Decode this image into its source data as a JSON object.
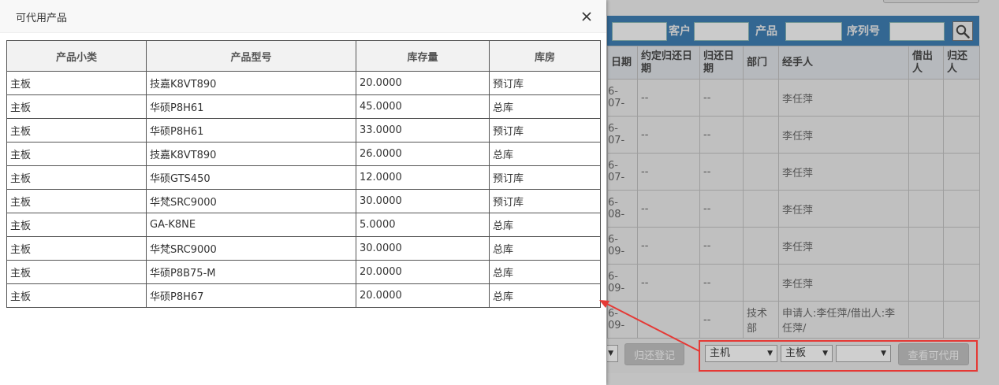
{
  "modal": {
    "title": "可代用产品",
    "table": {
      "headers": [
        "产品小类",
        "产品型号",
        "库存量",
        "库房"
      ],
      "rows": [
        [
          "主板",
          "技嘉K8VT890",
          "20.0000",
          "预订库"
        ],
        [
          "主板",
          "华硕P8H61",
          "45.0000",
          "总库"
        ],
        [
          "主板",
          "华硕P8H61",
          "33.0000",
          "预订库"
        ],
        [
          "主板",
          "技嘉K8VT890",
          "26.0000",
          "总库"
        ],
        [
          "主板",
          "华硕GTS450",
          "12.0000",
          "预订库"
        ],
        [
          "主板",
          "华梵SRC9000",
          "30.0000",
          "预订库"
        ],
        [
          "主板",
          "GA-K8NE",
          "5.0000",
          "总库"
        ],
        [
          "主板",
          "华梵SRC9000",
          "30.0000",
          "总库"
        ],
        [
          "主板",
          "华硕P8B75-M",
          "20.0000",
          "总库"
        ],
        [
          "主板",
          "华硕P8H67",
          "20.0000",
          "总库"
        ]
      ]
    }
  },
  "background": {
    "search": {
      "customer_label": "客户",
      "product_label": "产品",
      "serial_label": "序列号"
    },
    "table": {
      "headers": [
        "日期",
        "约定归还日期",
        "归还日期",
        "部门",
        "经手人",
        "借出人",
        "归还人"
      ],
      "rows": [
        [
          "6-07-",
          "--",
          "--",
          "",
          "李任萍",
          "",
          ""
        ],
        [
          "6-07-",
          "--",
          "--",
          "",
          "李任萍",
          "",
          ""
        ],
        [
          "6-07-",
          "--",
          "--",
          "",
          "李任萍",
          "",
          ""
        ],
        [
          "6-08-",
          "--",
          "--",
          "",
          "李任萍",
          "",
          ""
        ],
        [
          "6-09-",
          "--",
          "--",
          "",
          "李任萍",
          "",
          ""
        ],
        [
          "6-09-",
          "--",
          "--",
          "",
          "李任萍",
          "",
          ""
        ],
        [
          "6-09-",
          "",
          "--",
          "技术部",
          "申请人:李任萍/借出人:李任萍/",
          "",
          ""
        ]
      ]
    },
    "footer": {
      "return_button": "归还登记",
      "select_category": "主机",
      "select_subcategory": "板",
      "select_subcategory_full": "主板",
      "select_third": "",
      "view_button": "查看可代用"
    }
  },
  "colors": {
    "highlight": "#e53935",
    "header_bar": "#2a6fa8"
  }
}
